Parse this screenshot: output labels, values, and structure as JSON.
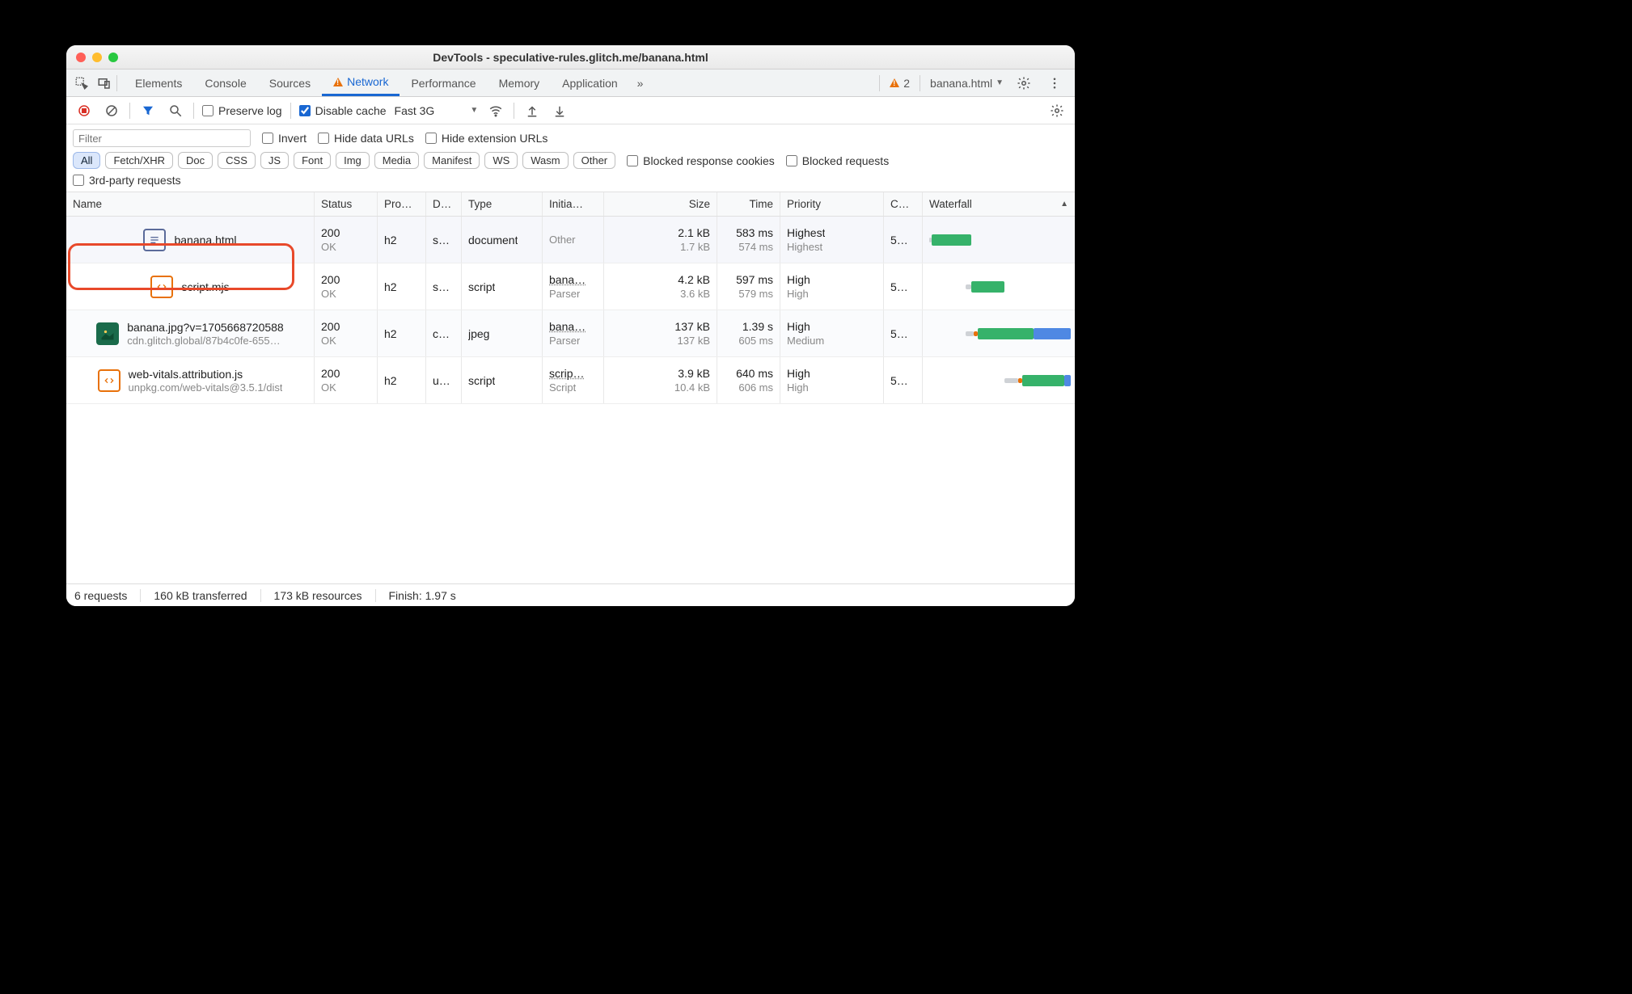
{
  "window": {
    "title": "DevTools - speculative-rules.glitch.me/banana.html",
    "context_label": "banana.html",
    "warning_count": "2"
  },
  "main_tabs": {
    "items": [
      "Elements",
      "Console",
      "Sources",
      "Network",
      "Performance",
      "Memory",
      "Application"
    ],
    "active": "Network",
    "more": "»"
  },
  "toolbar": {
    "preserve_log": "Preserve log",
    "disable_cache": "Disable cache",
    "throttling": "Fast 3G"
  },
  "filterbar": {
    "filter_placeholder": "Filter",
    "invert": "Invert",
    "hide_data_urls": "Hide data URLs",
    "hide_extension_urls": "Hide extension URLs",
    "chips": [
      "All",
      "Fetch/XHR",
      "Doc",
      "CSS",
      "JS",
      "Font",
      "Img",
      "Media",
      "Manifest",
      "WS",
      "Wasm",
      "Other"
    ],
    "blocked_cookies": "Blocked response cookies",
    "blocked_requests": "Blocked requests",
    "third_party": "3rd-party requests"
  },
  "columns": {
    "name": "Name",
    "status": "Status",
    "protocol": "Pro…",
    "domain": "D…",
    "type": "Type",
    "initiator": "Initia…",
    "size": "Size",
    "time": "Time",
    "priority": "Priority",
    "conn": "C…",
    "waterfall": "Waterfall"
  },
  "rows": [
    {
      "icon": "doc",
      "name": "banana.html",
      "name_sub": "",
      "status": "200",
      "status_sub": "OK",
      "protocol": "h2",
      "domain": "sp…",
      "type": "document",
      "initiator": "Other",
      "initiator_sub": "",
      "size": "2.1 kB",
      "size_sub": "1.7 kB",
      "time": "583 ms",
      "time_sub": "574 ms",
      "priority": "Highest",
      "priority_sub": "Highest",
      "conn": "5…",
      "wf": {
        "q": [
          0,
          2
        ],
        "wait": [
          2,
          28
        ],
        "dl": [
          0,
          0
        ]
      },
      "selected": true,
      "highlighted": true
    },
    {
      "icon": "js",
      "name": "script.mjs",
      "name_sub": "",
      "status": "200",
      "status_sub": "OK",
      "protocol": "h2",
      "domain": "sp…",
      "type": "script",
      "initiator": "bana…",
      "initiator_sub": "Parser",
      "size": "4.2 kB",
      "size_sub": "3.6 kB",
      "time": "597 ms",
      "time_sub": "579 ms",
      "priority": "High",
      "priority_sub": "High",
      "conn": "5…",
      "wf": {
        "q": [
          26,
          4
        ],
        "wait": [
          30,
          24
        ],
        "dl": [
          0,
          0
        ]
      }
    },
    {
      "icon": "img",
      "name": "banana.jpg?v=1705668720588",
      "name_sub": "cdn.glitch.global/87b4c0fe-655…",
      "status": "200",
      "status_sub": "OK",
      "protocol": "h2",
      "domain": "cd…",
      "type": "jpeg",
      "initiator": "bana…",
      "initiator_sub": "Parser",
      "size": "137 kB",
      "size_sub": "137 kB",
      "time": "1.39 s",
      "time_sub": "605 ms",
      "priority": "High",
      "priority_sub": "Medium",
      "conn": "5…",
      "wf": {
        "q": [
          26,
          6
        ],
        "dns": [
          32,
          3
        ],
        "wait": [
          35,
          40
        ],
        "dl": [
          75,
          27
        ]
      },
      "alt": true
    },
    {
      "icon": "js",
      "name": "web-vitals.attribution.js",
      "name_sub": "unpkg.com/web-vitals@3.5.1/dist",
      "status": "200",
      "status_sub": "OK",
      "protocol": "h2",
      "domain": "un…",
      "type": "script",
      "initiator": "scrip…",
      "initiator_sub": "Script",
      "size": "3.9 kB",
      "size_sub": "10.4 kB",
      "time": "640 ms",
      "time_sub": "606 ms",
      "priority": "High",
      "priority_sub": "High",
      "conn": "5…",
      "wf": {
        "q": [
          54,
          10
        ],
        "dns": [
          64,
          3
        ],
        "wait": [
          67,
          30
        ],
        "dl": [
          97,
          5
        ]
      }
    }
  ],
  "statusbar": {
    "requests": "6 requests",
    "transferred": "160 kB transferred",
    "resources": "173 kB resources",
    "finish": "Finish: 1.97 s"
  }
}
